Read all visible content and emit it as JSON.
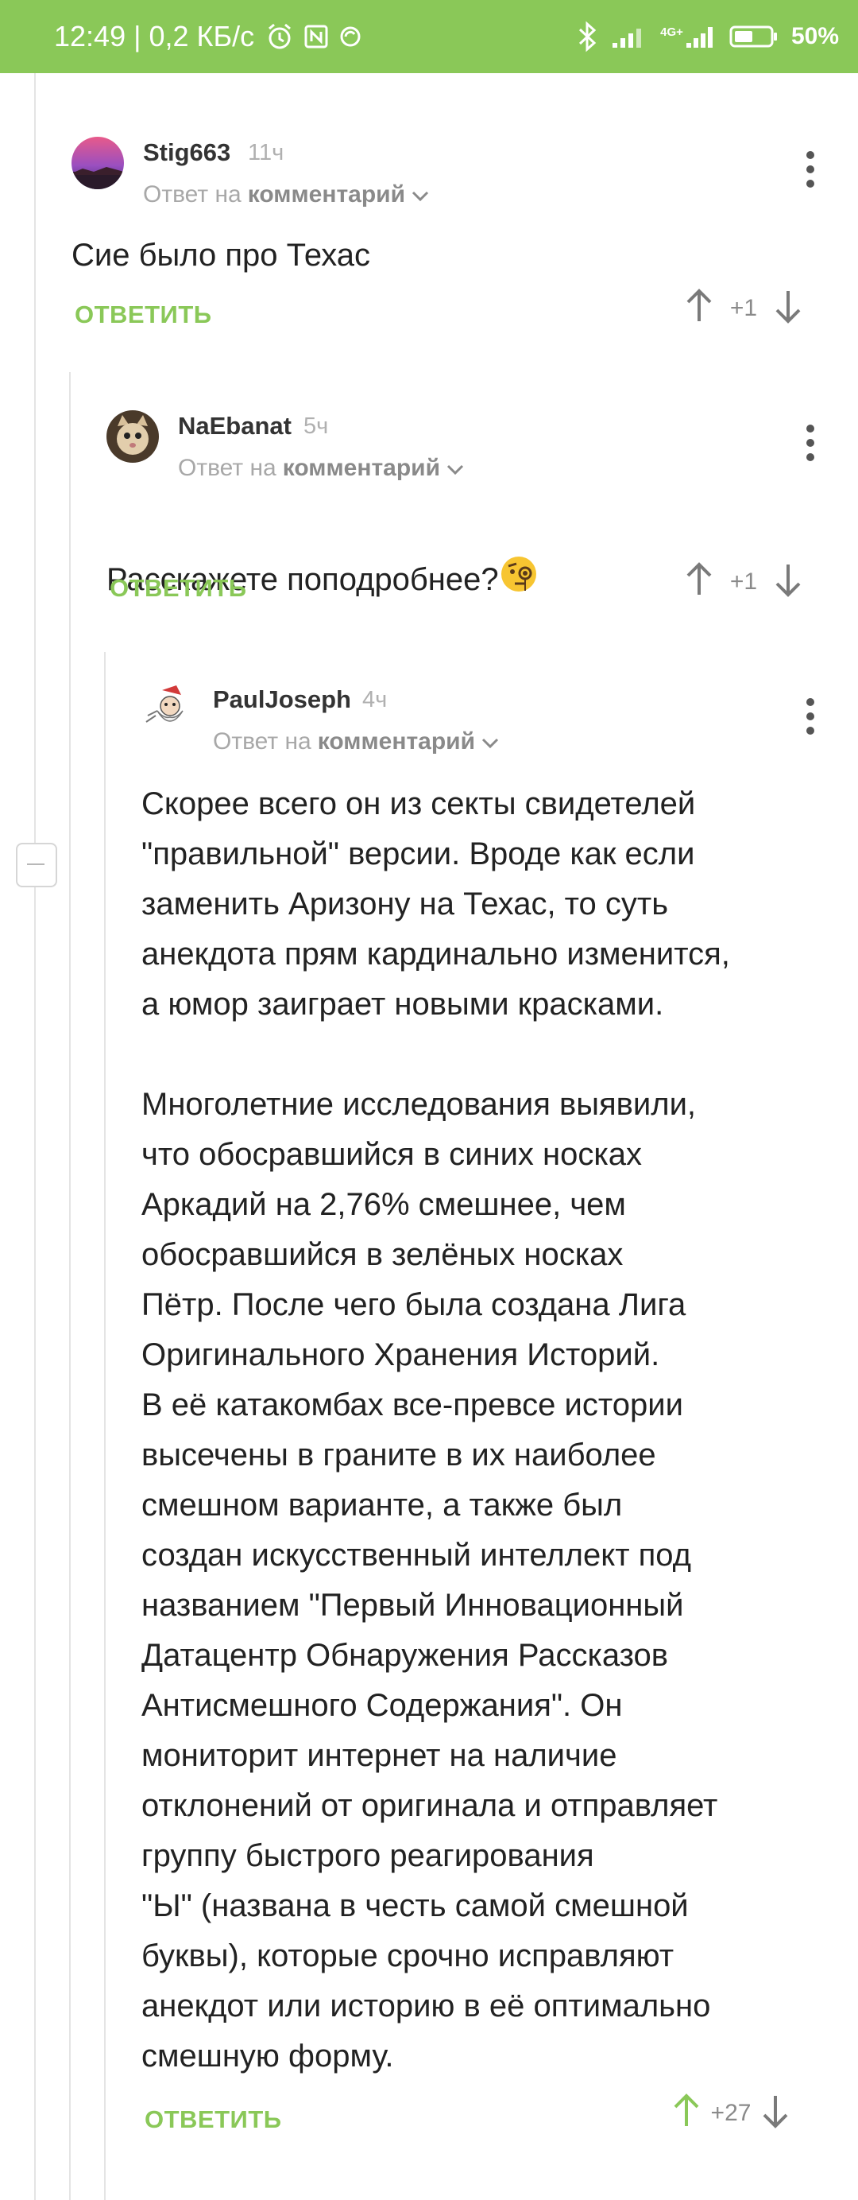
{
  "status_bar": {
    "time": "12:49",
    "net_speed": "0,2 КБ/с",
    "battery": "50%",
    "network": "4G+"
  },
  "comments": [
    {
      "username": "Stig663",
      "time": "11ч",
      "reply_prefix": "Ответ на",
      "reply_target": "комментарий",
      "body": "Сие было про Техас",
      "answer_label": "ОТВЕТИТЬ",
      "score": "+1"
    },
    {
      "username": "NaEbanat",
      "time": "5ч",
      "reply_prefix": "Ответ на",
      "reply_target": "комментарий",
      "body": "Расскажете поподробнее?",
      "answer_label": "ОТВЕТИТЬ",
      "score": "+1"
    },
    {
      "username": "PaulJoseph",
      "time": "4ч",
      "reply_prefix": "Ответ на",
      "reply_target": "комментарий",
      "body": "Скорее всего он из секты свидетелей\n\"правильной\" версии. Вроде как если\nзаменить Аризону на Техас, то суть\nанекдота прям кардинально изменится,\nа юмор заиграет новыми красками.\n\nМноголетние исследования выявили,\nчто обосравшийся в синих носках\nАркадий на 2,76% смешнее, чем\nобосравшийся в зелёных носках\nПётр. После чего была создана Лига\nОригинального Хранения Историй.\nВ её катакомбах все-превсе истории\nвысечены в граните в их наиболее\nсмешном варианте, а также был\nсоздан искусственный интеллект под\nназванием \"Первый Инновационный\nДатацентр Обнаружения Рассказов\nАнтисмешного Содержания\". Он\nмониторит интернет на наличие\nотклонений от оригинала и отправляет\nгруппу быстрого реагирования\n\"Ы\" (названа в честь самой смешной\nбуквы), которые срочно исправляют\nанекдот или историю в её оптимально\nсмешную форму.",
      "answer_label": "ОТВЕТИТЬ",
      "score": "+27"
    }
  ],
  "colors": {
    "accent": "#8ac858",
    "upvoted": "#8ac858",
    "arrow_default": "#7a7a7a"
  }
}
